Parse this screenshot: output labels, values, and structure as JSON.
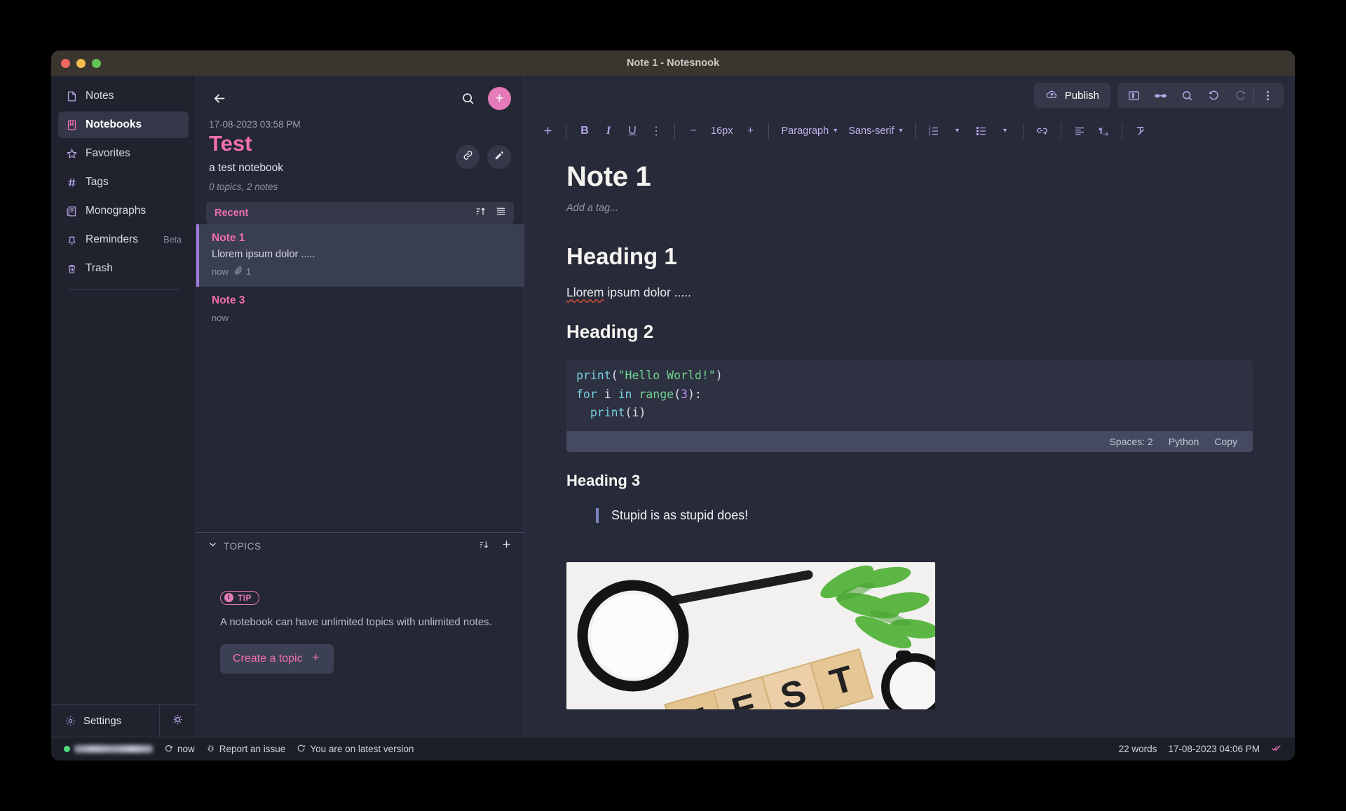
{
  "window": {
    "title": "Note 1 - Notesnook"
  },
  "sidebar": {
    "items": [
      {
        "label": "Notes",
        "icon": "note-icon",
        "badge": ""
      },
      {
        "label": "Notebooks",
        "icon": "notebook-icon",
        "badge": ""
      },
      {
        "label": "Favorites",
        "icon": "star-icon",
        "badge": ""
      },
      {
        "label": "Tags",
        "icon": "hash-icon",
        "badge": ""
      },
      {
        "label": "Monographs",
        "icon": "monograph-icon",
        "badge": ""
      },
      {
        "label": "Reminders",
        "icon": "bell-icon",
        "badge": "Beta"
      },
      {
        "label": "Trash",
        "icon": "trash-icon",
        "badge": ""
      }
    ],
    "active_index": 1,
    "settings_label": "Settings",
    "settings_icon": "gear-icon",
    "theme_toggle_icon": "brightness-icon"
  },
  "list_pane": {
    "back_icon": "arrow-left-icon",
    "search_icon": "search-icon",
    "add_label": "+",
    "notebook": {
      "date": "17-08-2023 03:58 PM",
      "title": "Test",
      "description": "a test notebook",
      "meta": "0 topics, 2 notes",
      "link_icon": "link-icon",
      "edit_icon": "pencil-icon"
    },
    "recent": {
      "label": "Recent",
      "sort_icon": "sort-ascending-icon",
      "view_icon": "list-view-icon"
    },
    "notes": [
      {
        "title": "Note 1",
        "preview": "Llorem ipsum dolor .....",
        "time": "now",
        "attachment_icon": "attachment-icon",
        "attachment_count": "1",
        "selected": true
      },
      {
        "title": "Note 3",
        "preview": "",
        "time": "now",
        "attachment_icon": "",
        "attachment_count": "",
        "selected": false
      }
    ],
    "topics": {
      "header": "TOPICS",
      "collapse_icon": "chevron-down-icon",
      "sort_icon": "sort-icon",
      "add_icon": "plus-icon",
      "tip_badge": "TIP",
      "tip_text": "A notebook can have unlimited topics with unlimited notes.",
      "create_label": "Create a topic"
    }
  },
  "editor": {
    "header": {
      "publish_label": "Publish",
      "publish_icon": "cloud-upload-icon",
      "buttons": [
        {
          "icon": "sidebar-toggle-icon",
          "dim": false
        },
        {
          "icon": "glasses-focus-icon",
          "dim": false
        },
        {
          "icon": "search-icon",
          "dim": false
        },
        {
          "icon": "undo-icon",
          "dim": false
        },
        {
          "icon": "redo-icon",
          "dim": true
        },
        {
          "icon": "more-vertical-icon",
          "dim": false
        }
      ]
    },
    "toolbar": {
      "insert_label": "+",
      "bold_label": "B",
      "italic_label": "I",
      "underline_label": "U",
      "more_label": "⋮",
      "font_decrease": "−",
      "font_size": "16px",
      "font_increase": "+",
      "block_type": "Paragraph",
      "font_family": "Sans-serif",
      "numbered_list_icon": "numbered-list-icon",
      "bullet_list_icon": "bullet-list-icon",
      "link_icon": "insert-link-icon",
      "align_icon": "align-left-icon",
      "direction_icon": "text-direction-icon",
      "clear_format_icon": "clear-formatting-icon"
    },
    "note": {
      "title": "Note 1",
      "tag_placeholder": "Add a tag...",
      "heading1": "Heading 1",
      "paragraph1_misspelled": "Llorem",
      "paragraph1_rest": " ipsum dolor .....",
      "heading2": "Heading 2",
      "code": {
        "line1_fn": "print",
        "line1_open": "(",
        "line1_str": "\"Hello World!\"",
        "line1_close": ")",
        "line2_kw1": "for",
        "line2_var": " i ",
        "line2_kw2": "in",
        "line2_fn": " range",
        "line2_open": "(",
        "line2_num": "3",
        "line2_close": "):",
        "line3_fn": "print",
        "line3_args": "(i)",
        "spaces": "Spaces: 2",
        "language": "Python",
        "copy": "Copy"
      },
      "heading3": "Heading 3",
      "quote": "Stupid is as stupid does!",
      "image_alt": "magnifying glass and TEST wooden blocks with plant and clock"
    }
  },
  "statusbar": {
    "user_masked": "",
    "sync_icon": "sync-icon",
    "sync_label": "now",
    "issue_icon": "bug-icon",
    "issue_label": "Report an issue",
    "version_icon": "clock-icon",
    "version_label": "You are on latest version",
    "word_count": "22 words",
    "saved_time": "17-08-2023 04:06 PM",
    "saved_icon": "double-check-icon"
  },
  "colors": {
    "accent_pink": "#f06fb0",
    "accent_purple": "#b8a6e8",
    "sidebar_bg": "#20222e",
    "list_bg": "#242734",
    "editor_bg": "#272a38"
  }
}
